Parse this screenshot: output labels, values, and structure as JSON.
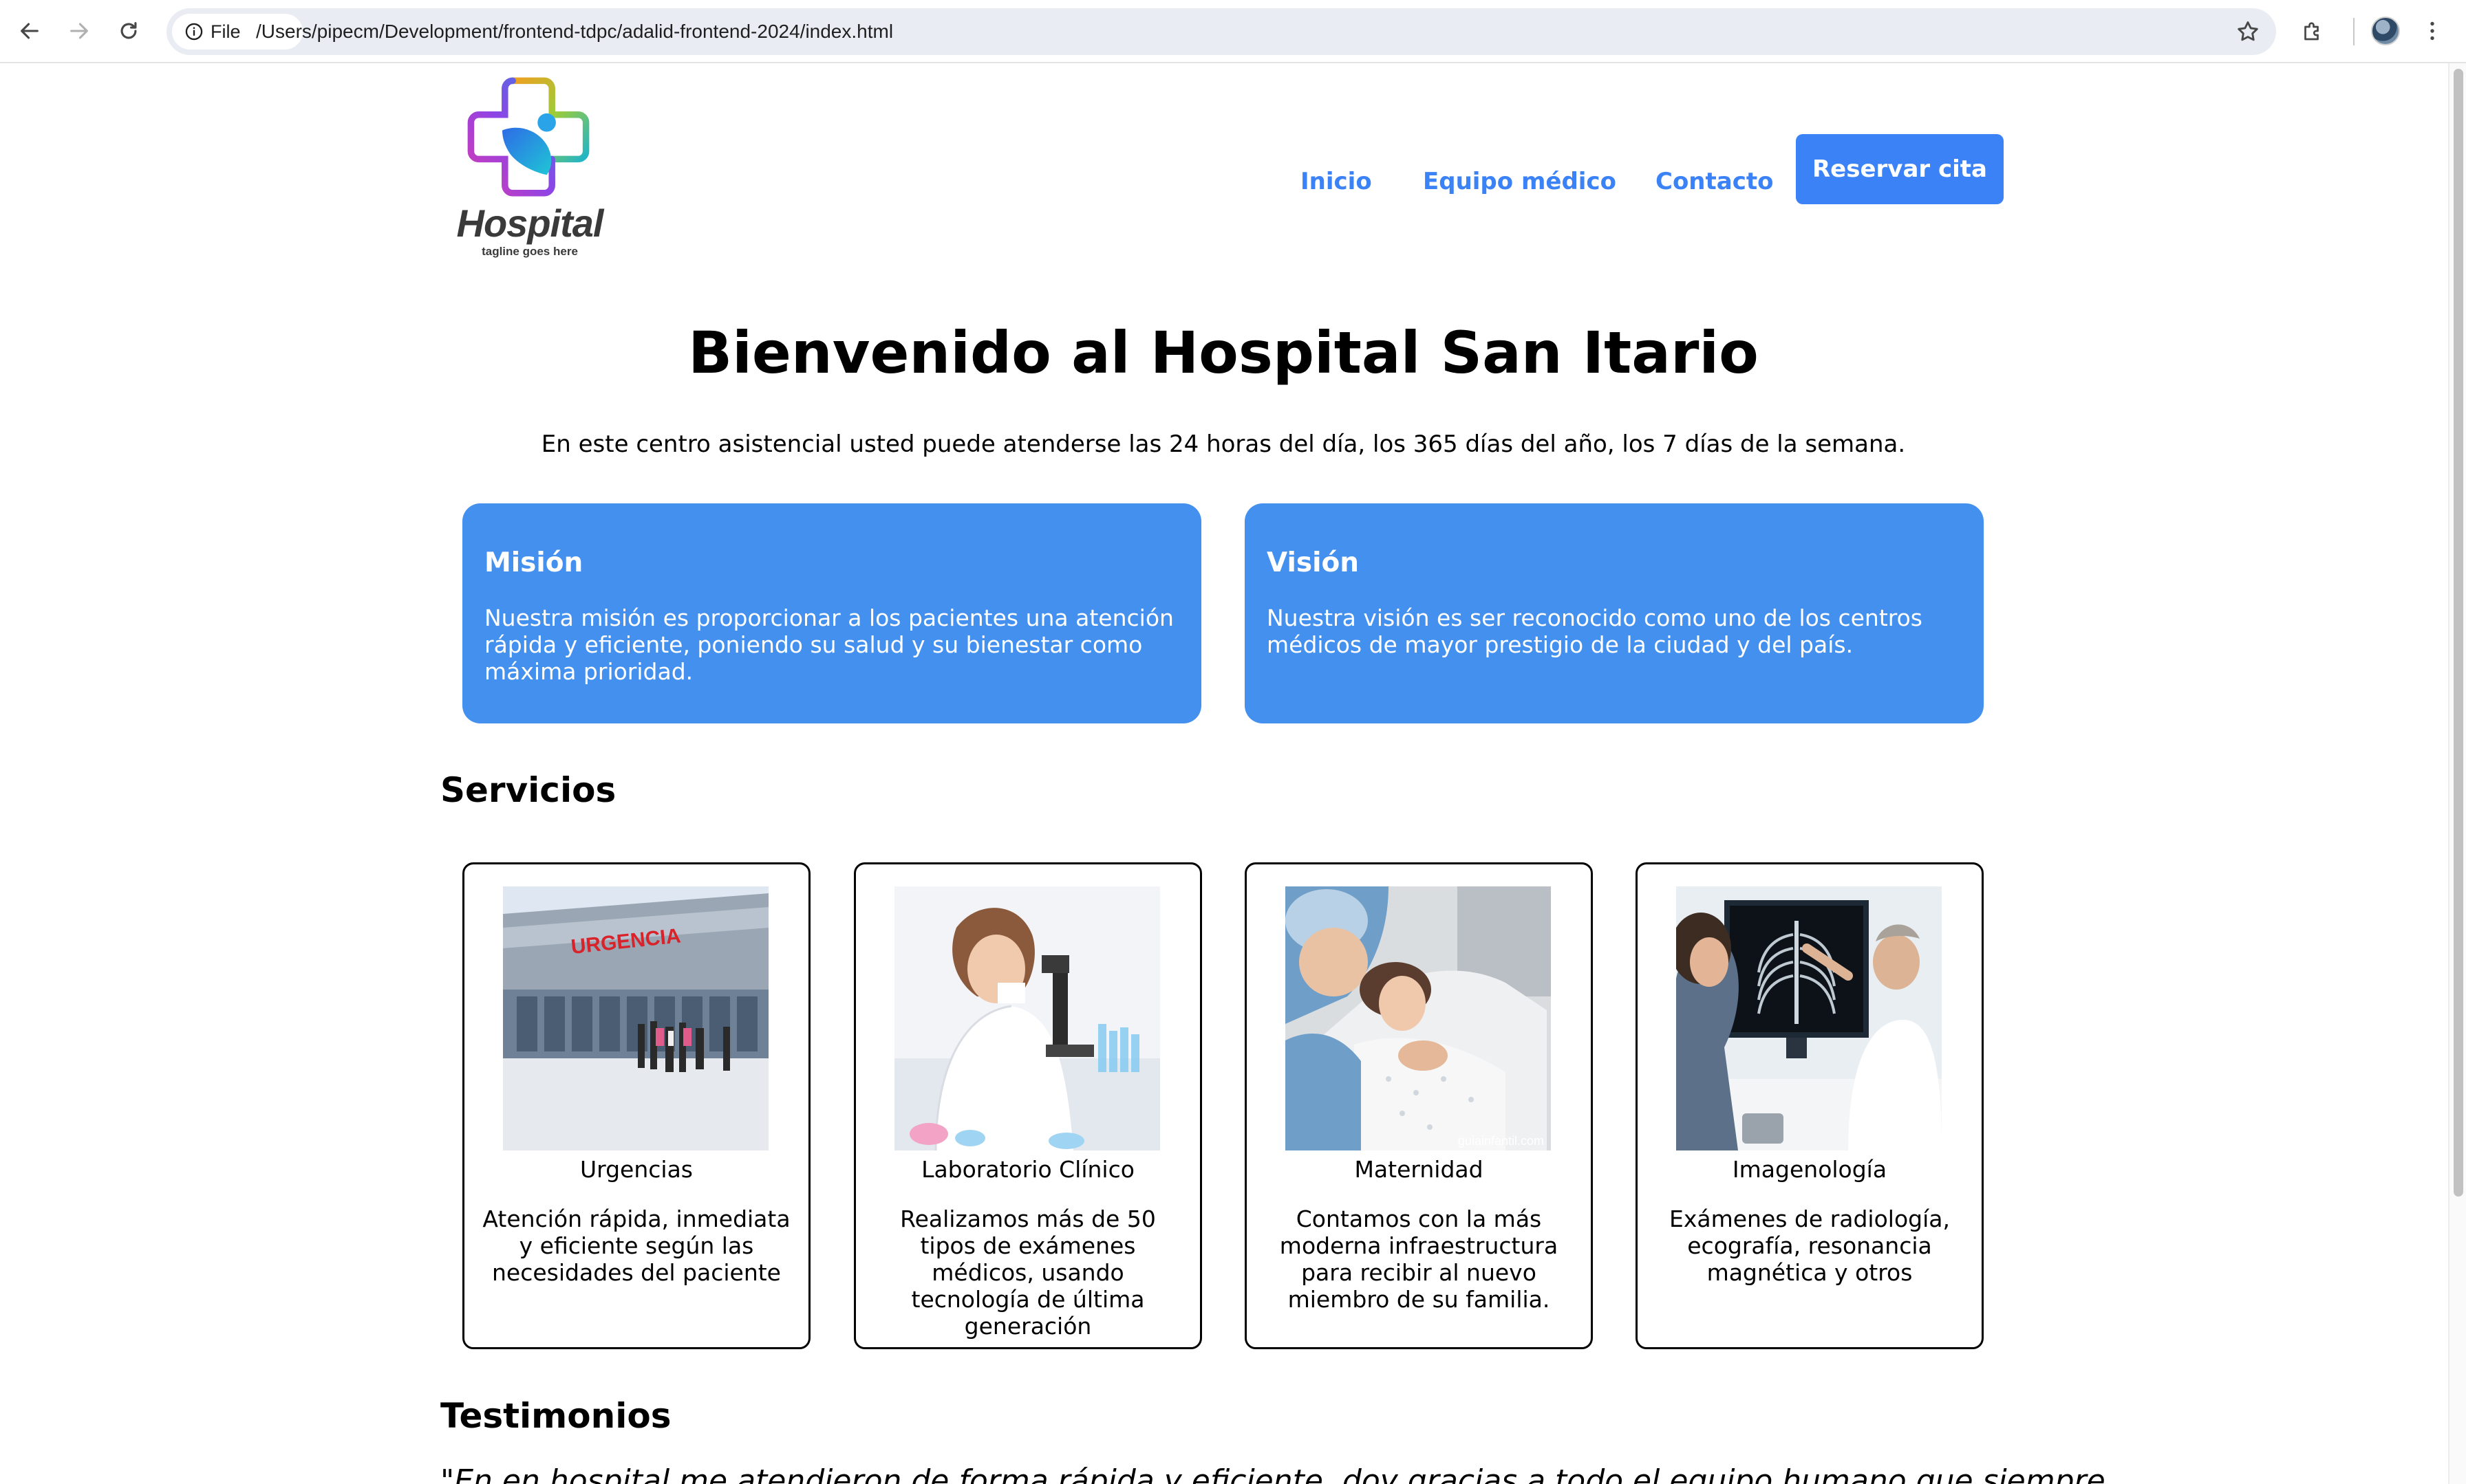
{
  "browser": {
    "site_chip_label": "File",
    "url": "/Users/pipecm/Development/frontend-tdpc/adalid-frontend-2024/index.html"
  },
  "header": {
    "logo_text": "Hospital",
    "logo_tagline": "tagline goes here",
    "nav": [
      {
        "label": "Inicio"
      },
      {
        "label": "Equipo médico"
      },
      {
        "label": "Contacto"
      }
    ],
    "cta_label": "Reservar cita",
    "accent_color": "#3b82f6"
  },
  "hero": {
    "title": "Bienvenido al Hospital San Itario",
    "subtitle": "En este centro asistencial usted puede atenderse las 24 horas del día, los 365 días del año, los 7 días de la semana."
  },
  "mission": {
    "title": "Misión",
    "text": "Nuestra misión es proporcionar a los pacientes una atención rápida y eficiente, poniendo su salud y su bienestar como máxima prioridad."
  },
  "vision": {
    "title": "Visión",
    "text": "Nuestra visión es ser reconocido como uno de los centros médicos de mayor prestigio de la ciudad y del país."
  },
  "services": {
    "title": "Servicios",
    "items": [
      {
        "name": "Urgencias",
        "description": "Atención rápida, inmediata y eficiente según las necesidades del paciente",
        "image_sign": "URGENCIA"
      },
      {
        "name": "Laboratorio Clínico",
        "description": "Realizamos más de 50 tipos de exámenes médicos, usando tecnología de última generación"
      },
      {
        "name": "Maternidad",
        "description": "Contamos con la más moderna infraestructura para recibir al nuevo miembro de su familia.",
        "image_watermark": "guiainfantil.com"
      },
      {
        "name": "Imagenología",
        "description": "Exámenes de radiología, ecografía, resonancia magnética y otros"
      }
    ]
  },
  "testimonials": {
    "title": "Testimonios",
    "first_quote_visible": "\"En en hospital me atendieron de forma rápida y eficiente, doy gracias a todo el equipo humano que siempre"
  }
}
